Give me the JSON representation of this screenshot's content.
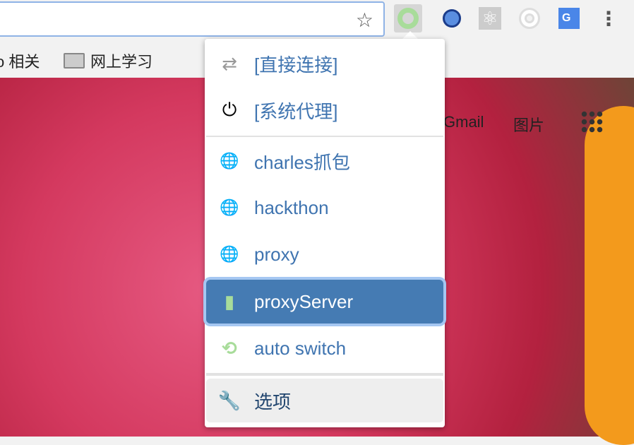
{
  "toolbar": {
    "star_icon": "star-icon",
    "extensions": [
      "switchyomega-icon",
      "magnifier-icon",
      "react-icon",
      "target-icon",
      "google-translate-icon"
    ],
    "menu_icon": "more-vert-icon"
  },
  "bookmarks": [
    {
      "label": "o 相关"
    },
    {
      "label": "网上学习"
    }
  ],
  "google": {
    "gmail": "Gmail",
    "images": "图片"
  },
  "menu": {
    "items": [
      {
        "label": "[直接连接]",
        "icon": "⇄",
        "color": "#999999"
      },
      {
        "label": "[系统代理]",
        "icon": "⏻",
        "color": "#000000"
      },
      {
        "label": "charles抓包",
        "icon": "🌐",
        "color": "#99c4ea"
      },
      {
        "label": "hackthon",
        "icon": "🌐",
        "color": "#99c4ea"
      },
      {
        "label": "proxy",
        "icon": "🌐",
        "color": "#99c4ea"
      },
      {
        "label": "proxyServer",
        "icon": "▮",
        "color": "#a8dc9a"
      },
      {
        "label": "auto switch",
        "icon": "⟲",
        "color": "#a8dc9a"
      }
    ],
    "options": {
      "label": "选项",
      "icon": "🔧"
    }
  },
  "colors": {
    "selected": "#457bb3",
    "link": "#3f74b0"
  }
}
